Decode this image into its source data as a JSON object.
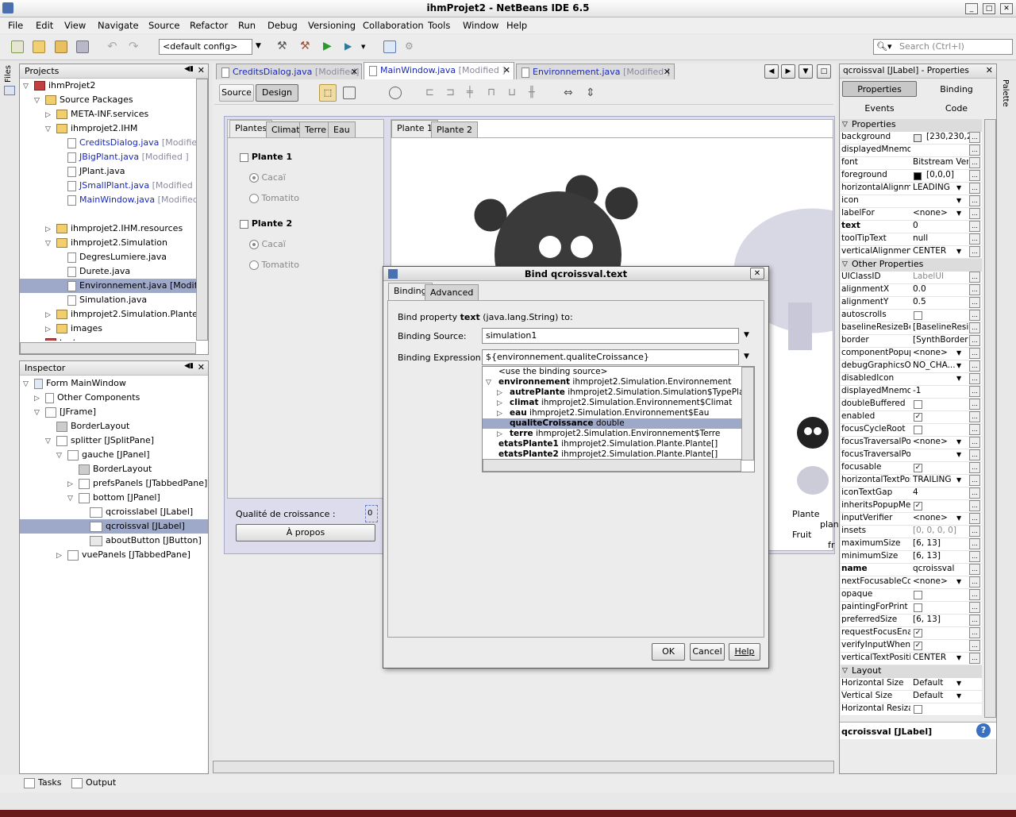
{
  "window": {
    "title": "ihmProjet2 - NetBeans IDE 6.5"
  },
  "menu": [
    "File",
    "Edit",
    "View",
    "Navigate",
    "Source",
    "Refactor",
    "Run",
    "Debug",
    "Versioning",
    "Collaboration",
    "Tools",
    "Window",
    "Help"
  ],
  "toolbar": {
    "config": "<default config>",
    "search_placeholder": "Search (Ctrl+I)"
  },
  "projects": {
    "title": "Projects",
    "items": [
      {
        "label": "ihmProjet2",
        "status": ""
      },
      {
        "label": "Source Packages",
        "status": ""
      },
      {
        "label": "META-INF.services",
        "status": ""
      },
      {
        "label": "ihmprojet2.IHM",
        "status": ""
      },
      {
        "label": "CreditsDialog.java",
        "status": "[Modified"
      },
      {
        "label": "JBigPlant.java",
        "status": "[Modified ]"
      },
      {
        "label": "JPlant.java",
        "status": ""
      },
      {
        "label": "JSmallPlant.java",
        "status": "[Modified ]"
      },
      {
        "label": "MainWindow.java",
        "status": "[Modified"
      },
      {
        "label": "ihmprojet2.IHM.resources",
        "status": ""
      },
      {
        "label": "ihmprojet2.Simulation",
        "status": ""
      },
      {
        "label": "DegresLumiere.java",
        "status": ""
      },
      {
        "label": "Durete.java",
        "status": ""
      },
      {
        "label": "Environnement.java [Modifi",
        "status": ""
      },
      {
        "label": "Simulation.java",
        "status": ""
      },
      {
        "label": "ihmprojet2.Simulation.Plante",
        "status": ""
      },
      {
        "label": "images",
        "status": ""
      },
      {
        "label": "test",
        "status": ""
      }
    ]
  },
  "inspector": {
    "title": "Inspector",
    "items": [
      "Form MainWindow",
      "Other Components",
      "[JFrame]",
      "BorderLayout",
      "splitter [JSplitPane]",
      "gauche [JPanel]",
      "BorderLayout",
      "prefsPanels [JTabbedPane]",
      "bottom [JPanel]",
      "qcroisslabel [JLabel]",
      "qcroissval [JLabel]",
      "aboutButton [JButton]",
      "vuePanels [JTabbedPane]"
    ]
  },
  "editor": {
    "tabs": [
      {
        "name": "CreditsDialog.java",
        "status": "[Modified]"
      },
      {
        "name": "MainWindow.java",
        "status": "[Modified ]"
      },
      {
        "name": "Environnement.java",
        "status": "[Modified ]"
      }
    ],
    "source_label": "Source",
    "design_label": "Design"
  },
  "form": {
    "left_tabs": [
      "Plantes",
      "Climat",
      "Terre",
      "Eau"
    ],
    "plante1": "Plante 1",
    "plante2": "Plante 2",
    "cacai": "Cacaï",
    "tomatito": "Tomatito",
    "qualite_label": "Qualité de croissance :",
    "qualite_value": "0",
    "apropos": "À propos",
    "right_tabs": [
      "Plante 1",
      "Plante 2"
    ],
    "plante_label": "Plante",
    "plan_label": "plan",
    "fruit_label": "Fruit",
    "fr_label": "fr"
  },
  "dialog": {
    "title": "Bind qcroissval.text",
    "tabs": [
      "Binding",
      "Advanced"
    ],
    "bind_property_prefix": "Bind property",
    "bind_property_name": "text",
    "bind_property_suffix": "(java.lang.String) to:",
    "source_label": "Binding Source:",
    "source_value": "simulation1",
    "expr_label": "Binding Expression:",
    "expr_value": "${environnement.qualiteCroissance}",
    "tree": [
      {
        "name": "<use the binding source>",
        "type": ""
      },
      {
        "name": "environnement",
        "type": "ihmprojet2.Simulation.Environnement"
      },
      {
        "name": "autrePlante",
        "type": "ihmprojet2.Simulation.Simulation$TypePlante"
      },
      {
        "name": "climat",
        "type": "ihmprojet2.Simulation.Environnement$Climat"
      },
      {
        "name": "eau",
        "type": "ihmprojet2.Simulation.Environnement$Eau"
      },
      {
        "name": "qualiteCroissance",
        "type": "double"
      },
      {
        "name": "terre",
        "type": "ihmprojet2.Simulation.Environnement$Terre"
      },
      {
        "name": "etatsPlante1",
        "type": "ihmprojet2.Simulation.Plante.Plante[]"
      },
      {
        "name": "etatsPlante2",
        "type": "ihmprojet2.Simulation.Plante.Plante[]"
      }
    ],
    "ok": "OK",
    "cancel": "Cancel",
    "help": "Help"
  },
  "properties": {
    "title": "qcroissval [JLabel] - Properties",
    "tabs": [
      "Properties",
      "Binding",
      "Events",
      "Code"
    ],
    "sections": [
      "Properties",
      "Other Properties",
      "Layout"
    ],
    "rows": [
      {
        "name": "background",
        "value": "[230,230,2"
      },
      {
        "name": "displayedMnemor",
        "value": ""
      },
      {
        "name": "font",
        "value": "Bitstream Ver"
      },
      {
        "name": "foreground",
        "value": "[0,0,0]"
      },
      {
        "name": "horizontalAlignme",
        "value": "LEADING"
      },
      {
        "name": "icon",
        "value": ""
      },
      {
        "name": "labelFor",
        "value": "<none>"
      },
      {
        "name": "text",
        "value": "0"
      },
      {
        "name": "toolTipText",
        "value": "null"
      },
      {
        "name": "verticalAlignment",
        "value": "CENTER"
      },
      {
        "name": "UIClassID",
        "value": "LabelUI"
      },
      {
        "name": "alignmentX",
        "value": "0.0"
      },
      {
        "name": "alignmentY",
        "value": "0.5"
      },
      {
        "name": "autoscrolls",
        "value": ""
      },
      {
        "name": "baselineResizeBeh",
        "value": "[BaselineResizeBe"
      },
      {
        "name": "border",
        "value": "[SynthBorder]"
      },
      {
        "name": "componentPopup",
        "value": "<none>"
      },
      {
        "name": "debugGraphicsOp",
        "value": "NO_CHA..."
      },
      {
        "name": "disabledIcon",
        "value": ""
      },
      {
        "name": "displayedMnemor",
        "value": "-1"
      },
      {
        "name": "doubleBuffered",
        "value": ""
      },
      {
        "name": "enabled",
        "value": ""
      },
      {
        "name": "focusCycleRoot",
        "value": ""
      },
      {
        "name": "focusTraversalPoli",
        "value": "<none>"
      },
      {
        "name": "focusTraversalPoli",
        "value": ""
      },
      {
        "name": "focusable",
        "value": ""
      },
      {
        "name": "horizontalTextPos",
        "value": "TRAILING"
      },
      {
        "name": "iconTextGap",
        "value": "4"
      },
      {
        "name": "inheritsPopupMen",
        "value": ""
      },
      {
        "name": "inputVerifier",
        "value": "<none>"
      },
      {
        "name": "insets",
        "value": "[0, 0, 0, 0]"
      },
      {
        "name": "maximumSize",
        "value": "[6, 13]"
      },
      {
        "name": "minimumSize",
        "value": "[6, 13]"
      },
      {
        "name": "name",
        "value": "qcroissval"
      },
      {
        "name": "nextFocusableCor",
        "value": "<none>"
      },
      {
        "name": "opaque",
        "value": ""
      },
      {
        "name": "paintingForPrint",
        "value": ""
      },
      {
        "name": "preferredSize",
        "value": "[6, 13]"
      },
      {
        "name": "requestFocusEnal",
        "value": ""
      },
      {
        "name": "verifyInputWhenF",
        "value": ""
      },
      {
        "name": "verticalTextPositic",
        "value": "CENTER"
      },
      {
        "name": "Horizontal Size",
        "value": "Default"
      },
      {
        "name": "Vertical Size",
        "value": "Default"
      },
      {
        "name": "Horizontal Resizab",
        "value": ""
      }
    ],
    "footer": "qcroissval [JLabel]"
  },
  "bottom_tabs": [
    "Tasks",
    "Output"
  ],
  "side": {
    "files": "Files",
    "palette": "Palette"
  }
}
